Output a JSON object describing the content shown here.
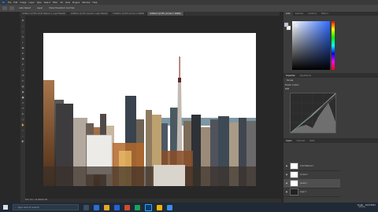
{
  "menubar": {
    "items": [
      "File",
      "Edit",
      "Image",
      "Layer",
      "Type",
      "Select",
      "Filter",
      "3D",
      "View",
      "Plugins",
      "Window",
      "Help"
    ]
  },
  "optbar": {
    "items": [
      "Auto-Select",
      "Layer",
      "Show Transform Controls"
    ]
  },
  "tabs": [
    {
      "label": "Untitled-1 @ 50% (Color Balance 1, Layer Mask/8)"
    },
    {
      "label": "Untitled-1 @ 50% (Levels 1, Layer Mask/8)"
    },
    {
      "label": "Untitled-1 @ 50% (Curves 1, RGB/8)"
    },
    {
      "label": "Untitled-1 @ 50% (Curves 1, RGB/8)"
    }
  ],
  "status": {
    "zoom": "50%",
    "doc": "Doc: 24.9M/94.5M"
  },
  "panels": {
    "color_tabs": [
      "Color",
      "Swatches",
      "Gradients",
      "Patterns"
    ],
    "properties_tabs": [
      "Properties",
      "Adjustments"
    ],
    "properties_title": "Curves",
    "preset": "Preset: Custom",
    "channel": "RGB",
    "layers_tabs": [
      "Layers",
      "Channels",
      "Paths"
    ]
  },
  "layers": [
    {
      "name": "Color Balance 1",
      "type": "adj"
    },
    {
      "name": "Curves 1",
      "type": "adj"
    },
    {
      "name": "Levels 1",
      "type": "adj",
      "active": true
    },
    {
      "name": "Layer 1",
      "type": "img"
    },
    {
      "name": "Hue/Saturation 1",
      "type": "adj"
    },
    {
      "name": "Background",
      "type": "img"
    }
  ],
  "taskbar": {
    "search_placeholder": "Type here to search",
    "time": "12:46",
    "date": "10/7/2021"
  },
  "watermark": "udemy",
  "colors": {
    "fg": "#c2c7d4",
    "bg": "#ffffff",
    "accent": "#31a8ff"
  }
}
